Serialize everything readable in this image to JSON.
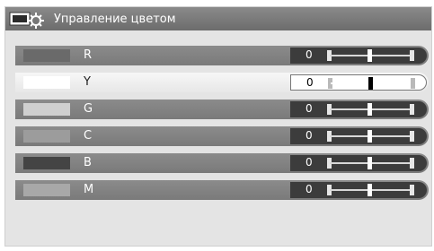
{
  "window": {
    "title": "Управление цветом",
    "icon": "color-management-icon"
  },
  "rows": [
    {
      "label": "R",
      "value": "0",
      "swatch_color": "#6a6a6a",
      "selected": false
    },
    {
      "label": "Y",
      "value": "0",
      "swatch_color": "#ffffff",
      "selected": true
    },
    {
      "label": "G",
      "value": "0",
      "swatch_color": "#cfcfcf",
      "selected": false
    },
    {
      "label": "C",
      "value": "0",
      "swatch_color": "#9c9c9c",
      "selected": false
    },
    {
      "label": "B",
      "value": "0",
      "swatch_color": "#444444",
      "selected": false
    },
    {
      "label": "M",
      "value": "0",
      "swatch_color": "#a8a8a8",
      "selected": false
    }
  ],
  "colors": {
    "titlebar": "#7a7a7a",
    "panel": "#e4e4e4",
    "row": "#838383",
    "row_selected": "#f0f0f0"
  }
}
